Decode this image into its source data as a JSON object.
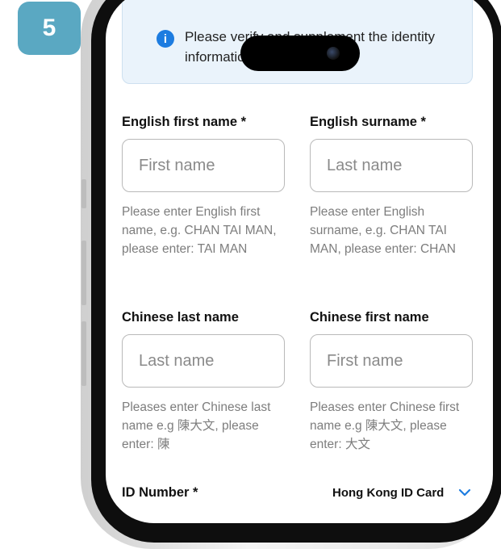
{
  "step": {
    "number": "5"
  },
  "notice": {
    "icon": "info-icon",
    "text": "Please verify and supplement the identity information"
  },
  "form": {
    "english_first_name": {
      "label": "English first name  *",
      "placeholder": "First name",
      "hint": "Please enter English first name, e.g. CHAN TAI MAN, please enter: TAI MAN"
    },
    "english_surname": {
      "label": "English surname  *",
      "placeholder": "Last name",
      "hint": "Please enter English surname, e.g. CHAN TAI MAN, please enter: CHAN"
    },
    "chinese_last_name": {
      "label": "Chinese last name",
      "placeholder": "Last name",
      "hint": "Pleases enter Chinese last name e.g 陳大文, please enter: 陳"
    },
    "chinese_first_name": {
      "label": "Chinese first name",
      "placeholder": "First name",
      "hint": "Pleases enter Chinese first name e.g 陳大文, please enter: 大文"
    },
    "id_number": {
      "label": "ID Number *",
      "doc_type": "Hong Kong ID Card",
      "dropdown_icon": "chevron-down-icon"
    }
  },
  "colors": {
    "step_badge": "#5aa8c2",
    "notice_bg": "#eaf3fb",
    "info_icon": "#1d7ce0",
    "chevron": "#1d7ce0"
  }
}
